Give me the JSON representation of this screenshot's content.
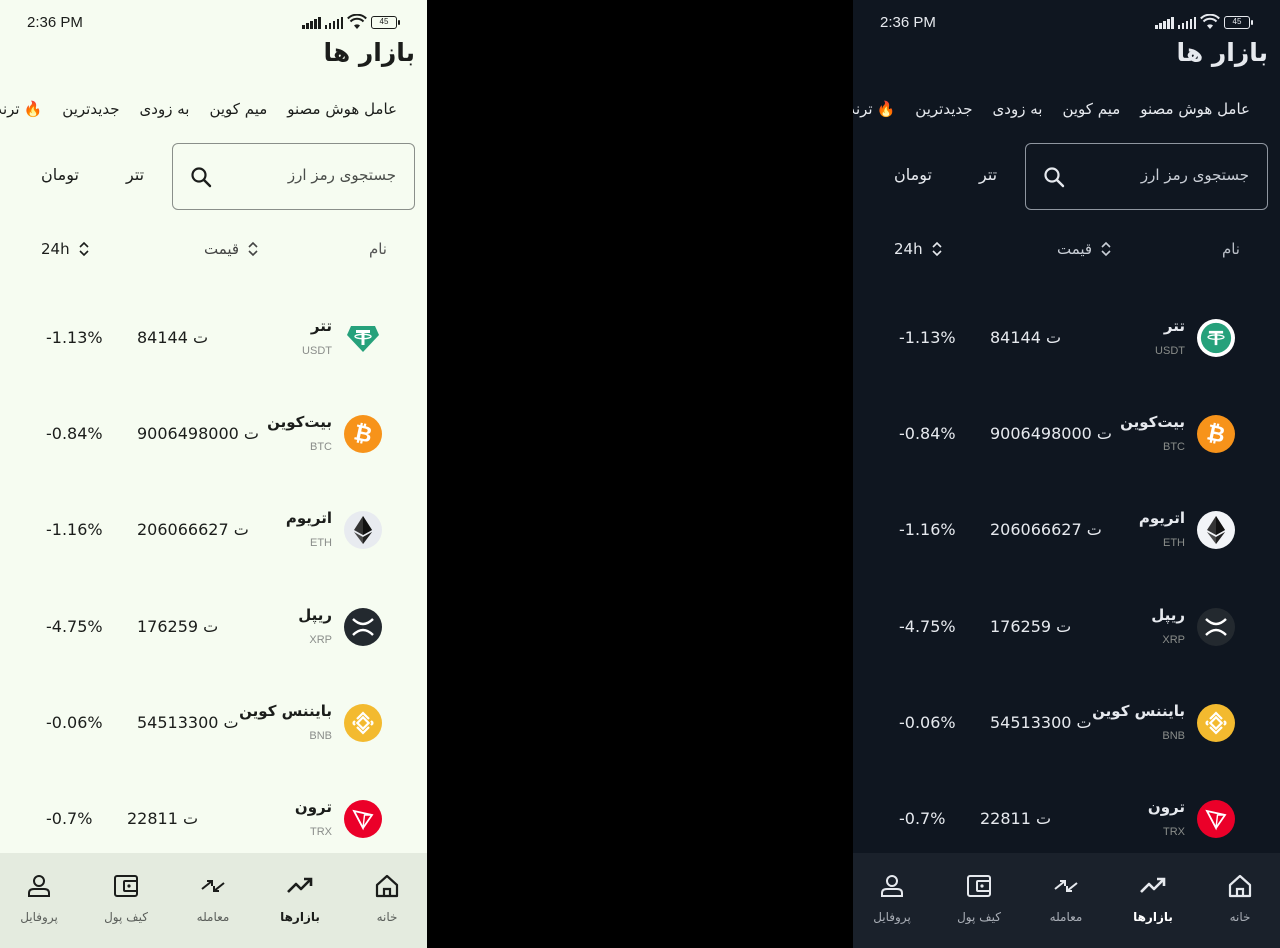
{
  "status": {
    "time": "2:36 PM",
    "battery": "45"
  },
  "page": {
    "title": "بازار ها"
  },
  "chips": [
    {
      "label": "ترند",
      "emoji": "🔥"
    },
    {
      "label": "جدیدترین"
    },
    {
      "label": "به زودی"
    },
    {
      "label": "میم کوین"
    },
    {
      "label": "عامل هوش مصنو"
    }
  ],
  "search": {
    "placeholder": "جستجوی رمز ارز"
  },
  "tabs": {
    "tether": "تتر",
    "toman": "تومان"
  },
  "columns": {
    "name": "نام",
    "price": "قیمت",
    "change": "24h"
  },
  "coins": [
    {
      "name": "تتر",
      "symbol": "USDT",
      "price": "ت 84144",
      "change": "-1.13%",
      "color": "#26a17b"
    },
    {
      "name": "بیت‌کوین",
      "symbol": "BTC",
      "price": "ت 9006498000",
      "change": "-0.84%",
      "color": "#f7931a"
    },
    {
      "name": "اتریوم",
      "symbol": "ETH",
      "price": "ت 206066627",
      "change": "-1.16%",
      "color": "#e8ebf0"
    },
    {
      "name": "ریپل",
      "symbol": "XRP",
      "price": "ت 176259",
      "change": "-4.75%",
      "color": "#23292f"
    },
    {
      "name": "بایننس کوین",
      "symbol": "BNB",
      "price": "ت 54513300",
      "change": "-0.06%",
      "color": "#f3ba2f"
    },
    {
      "name": "ترون",
      "symbol": "TRX",
      "price": "ت 22811",
      "change": "-0.7%",
      "color": "#eb0029"
    }
  ],
  "nav": {
    "home": "خانه",
    "markets": "بازارها",
    "trade": "معامله",
    "wallet": "کیف پول",
    "profile": "پروفایل"
  },
  "themes": {
    "light_bg": "#f6fcf1",
    "dark_bg": "#0f1620"
  }
}
